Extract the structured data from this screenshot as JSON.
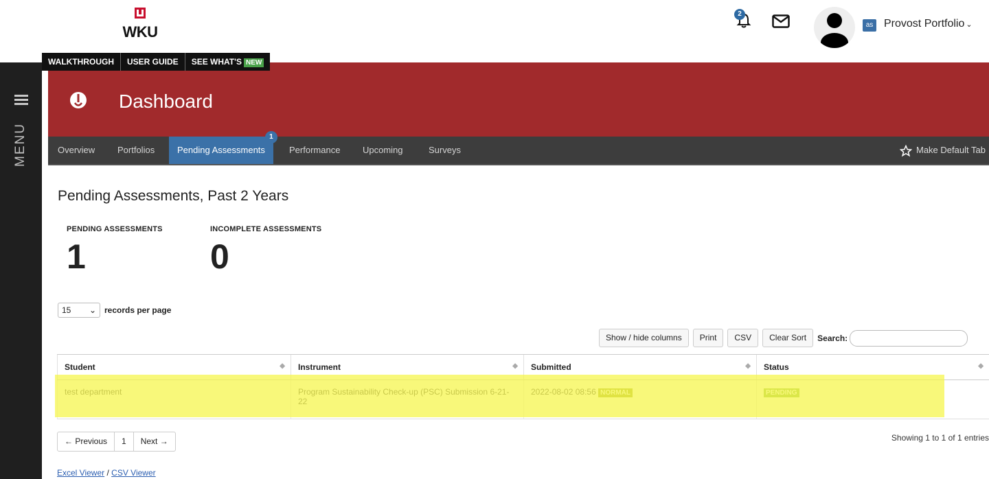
{
  "header": {
    "logo_text": "WKU",
    "notifications_count": "2",
    "account_badge": "as",
    "account_name": "Provost Portfolio"
  },
  "help_links": {
    "walkthrough": "WALKTHROUGH",
    "user_guide": "USER GUIDE",
    "see_whats": "SEE WHAT'S",
    "new_badge": "NEW"
  },
  "menu": {
    "label": "MENU"
  },
  "banner": {
    "title": "Dashboard"
  },
  "tabs": [
    {
      "label": "Overview"
    },
    {
      "label": "Portfolios"
    },
    {
      "label": "Pending Assessments",
      "badge": "1"
    },
    {
      "label": "Performance"
    },
    {
      "label": "Upcoming"
    },
    {
      "label": "Surveys"
    }
  ],
  "make_default_label": "Make Default Tab",
  "section_title": "Pending Assessments, Past 2 Years",
  "stats": {
    "pending": {
      "label_a": "PENDING",
      "label_b": "ASSESSMENTS",
      "value": "1"
    },
    "incomplete": {
      "label_a": "INCOMPLETE",
      "label_b": "ASSESSMENTS",
      "value": "0"
    }
  },
  "per_page": {
    "value": "15",
    "label": "records per page"
  },
  "toolbar": {
    "show_hide": "Show / hide columns",
    "print": "Print",
    "csv": "CSV",
    "clear_sort": "Clear Sort",
    "search_label": "Search:"
  },
  "table": {
    "columns": [
      "Student",
      "Instrument",
      "Submitted",
      "Status"
    ],
    "rows": [
      {
        "student": "test department",
        "instrument": "Program Sustainability Check-up (PSC) Submission 6-21-22",
        "submitted": "2022-08-02 08:56",
        "submitted_badge": "NORMAL",
        "status": "PENDING"
      }
    ]
  },
  "pagination": {
    "previous": "← Previous",
    "page": "1",
    "next": "Next →"
  },
  "showing": "Showing 1 to 1 of 1 entries",
  "viewers": {
    "excel": "Excel Viewer",
    "separator": " / ",
    "csv": "CSV Viewer"
  },
  "colors": {
    "banner": "#a12a2c",
    "tab_active": "#3b71a8",
    "highlight": "#f5f546"
  }
}
